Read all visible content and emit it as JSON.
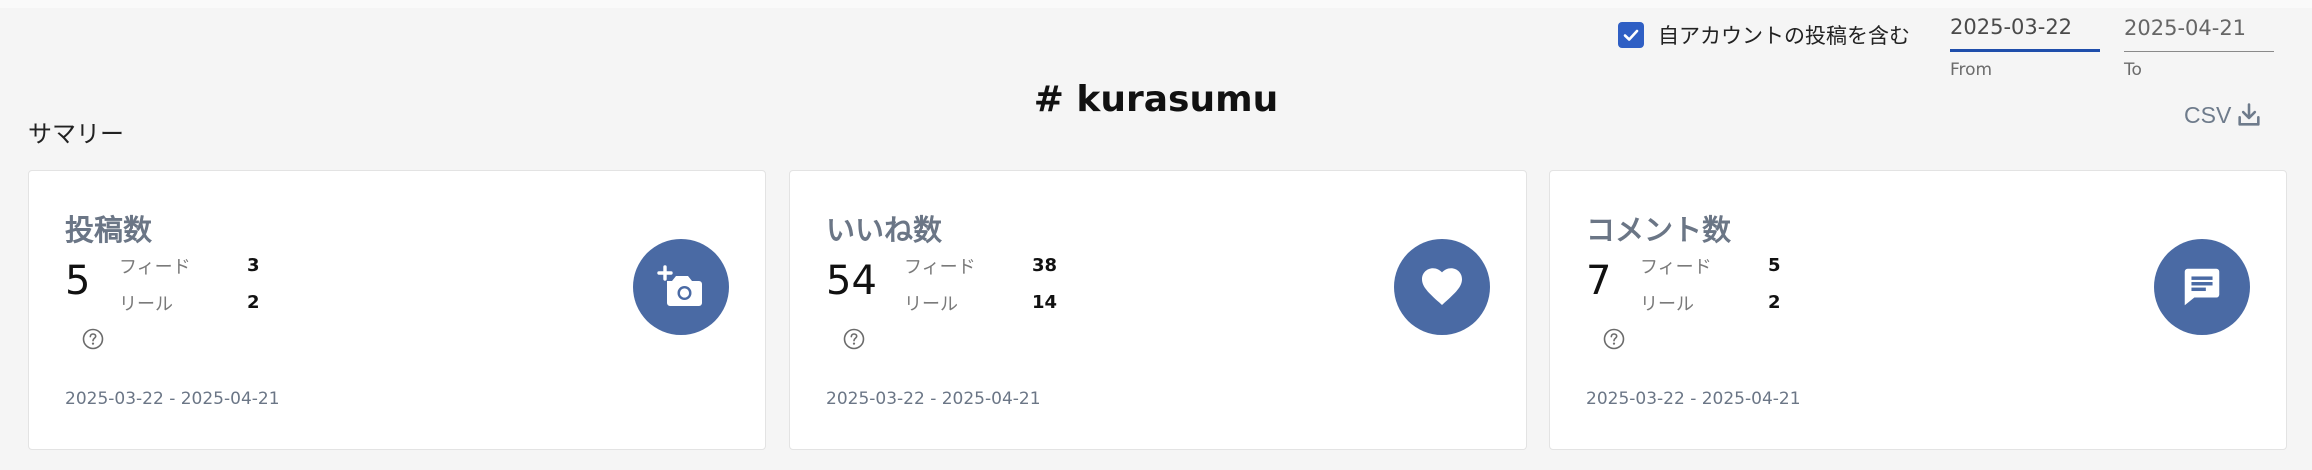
{
  "header": {
    "title": "# kurasumu",
    "include_own_label": "自アカウントの投稿を含む",
    "include_own_checked": true,
    "from": {
      "value": "2025-03-22",
      "label": "From"
    },
    "to": {
      "value": "2025-04-21",
      "label": "To"
    },
    "csv_label": "CSV"
  },
  "summary": {
    "section_label": "サマリー",
    "cards": [
      {
        "title": "投稿数",
        "total": "5",
        "rows": [
          {
            "label": "フィード",
            "value": "3"
          },
          {
            "label": "リール",
            "value": "2"
          }
        ],
        "range": "2025-03-22 - 2025-04-21",
        "icon": "add-photo-icon"
      },
      {
        "title": "いいね数",
        "total": "54",
        "rows": [
          {
            "label": "フィード",
            "value": "38"
          },
          {
            "label": "リール",
            "value": "14"
          }
        ],
        "range": "2025-03-22 - 2025-04-21",
        "icon": "heart-icon"
      },
      {
        "title": "コメント数",
        "total": "7",
        "rows": [
          {
            "label": "フィード",
            "value": "5"
          },
          {
            "label": "リール",
            "value": "2"
          }
        ],
        "range": "2025-03-22 - 2025-04-21",
        "icon": "comment-icon"
      }
    ]
  },
  "colors": {
    "accent": "#2f5fc4",
    "icon_circle": "#4a6aa4",
    "muted_text": "#6b7686"
  }
}
